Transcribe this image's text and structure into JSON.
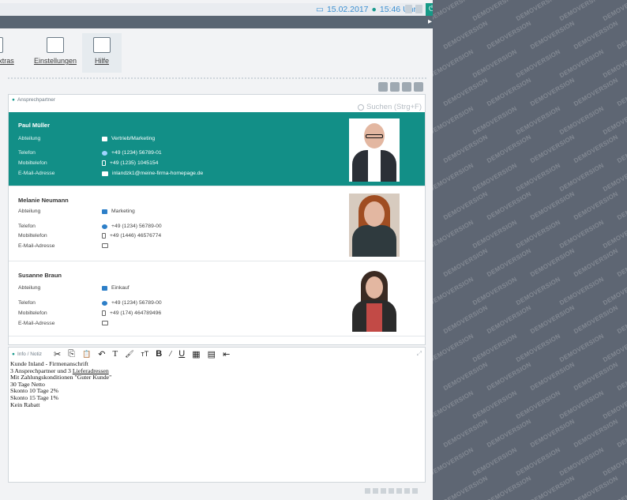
{
  "topbar": {
    "datetime_date": "15.02.2017",
    "datetime_sep": "●",
    "datetime_time": "15:46 Uhr",
    "power_glyph": "⏻"
  },
  "ribbon": {
    "items": [
      {
        "label": "xtras",
        "icon": "extras-icon"
      },
      {
        "label": "Einstellungen",
        "icon": "settings-icon"
      },
      {
        "label": "Hilfe",
        "icon": "help-icon"
      }
    ]
  },
  "contacts": {
    "section_title": "Ansprechpartner",
    "search_placeholder": "Suchen (Strg+F)",
    "labels": {
      "abteilung": "Abteilung",
      "telefon": "Telefon",
      "mobil": "Mobiltelefon",
      "email": "E-Mail-Adresse"
    },
    "items": [
      {
        "name": "Paul Müller",
        "department": "Vertrieb/Marketing",
        "phone": "+49 (1234) 56789-01",
        "mobile": "+49 (1235) 1045154",
        "email": "inlandzk1@meine-firma-homepage.de"
      },
      {
        "name": "Melanie Neumann",
        "department": "Marketing",
        "phone": "+49 (1234) 56789-00",
        "mobile": "+49 (1446) 46576774",
        "email": ""
      },
      {
        "name": "Susanne Braun",
        "department": "Einkauf",
        "phone": "+49 (1234) 56789-00",
        "mobile": "+49 (174) 464789496",
        "email": ""
      }
    ]
  },
  "notes": {
    "section_title": "Info / Notiz",
    "toolbar": {
      "cut": "✂",
      "copy": "⎘",
      "paste": "📋",
      "undo": "↶",
      "font": "T",
      "fill": "🖌",
      "size": "тT",
      "bold": "B",
      "italic": "/",
      "underline": "U",
      "table": "▦",
      "doc": "▤",
      "exit": "⇤"
    },
    "expand_glyph": "⤢",
    "lines": [
      "Kunde Inland - Firmenanschrift",
      "3 Ansprechpartner und 3 ",
      "Lieferadressen",
      "Mit Zahlungskonditionen \"Guter Kunde\"",
      "30 Tage Netto",
      "Skonto 10 Tage 2%",
      "Skonto 15 Tage 1%",
      "Kein Rabatt"
    ]
  },
  "watermark": {
    "text": "DEMOVERSION"
  },
  "colors": {
    "accent": "#128f87",
    "topbar_dark": "#596572",
    "demo_bg": "#5e6673",
    "link_blue": "#3b8fd1"
  }
}
